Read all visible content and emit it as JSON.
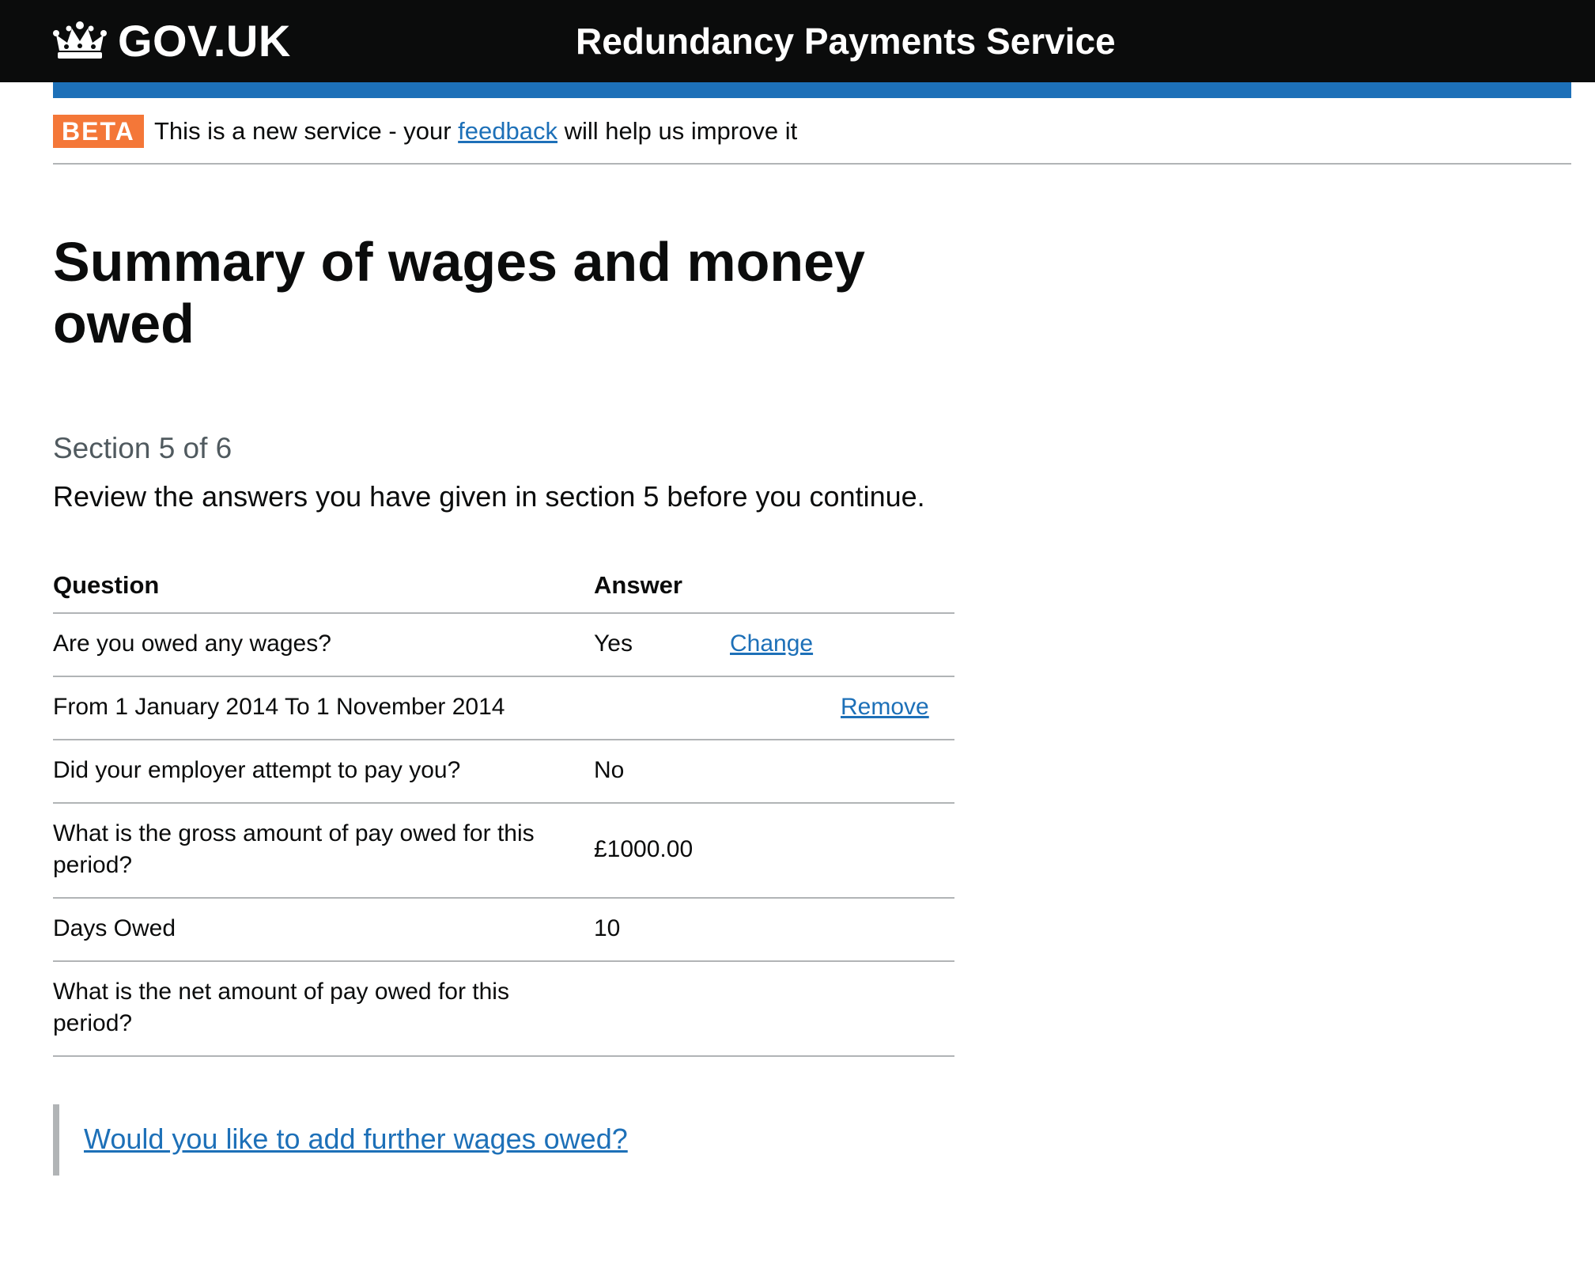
{
  "header": {
    "logo_text": "GOV.UK",
    "service_name": "Redundancy Payments Service",
    "logo_icon": "crown-icon",
    "background": "#0b0c0c",
    "accent_bar": "#1d70b8"
  },
  "phase_banner": {
    "tag": "BETA",
    "tag_color": "#f47738",
    "text_before": "This is a new service - your ",
    "link": "feedback",
    "text_after": " will help us improve it"
  },
  "page": {
    "title": "Summary of wages and money owed",
    "caption": "Section 5 of 6",
    "intro": "Review the answers you have given in section 5 before you continue."
  },
  "summary": {
    "headers": {
      "question": "Question",
      "answer": "Answer"
    },
    "rows": [
      {
        "question": "Are you owed any wages?",
        "answer": "Yes",
        "action": "Change"
      },
      {
        "question": "From 1 January 2014 To 1 November 2014",
        "answer": "",
        "action": "Remove"
      },
      {
        "question": "Did your employer attempt to pay you?",
        "answer": "No",
        "action": ""
      },
      {
        "question": "What is the gross amount of pay owed for this period?",
        "answer": "£1000.00",
        "action": ""
      },
      {
        "question": "Days Owed",
        "answer": "10",
        "action": ""
      },
      {
        "question": "What is the net amount of pay owed for this period?",
        "answer": "",
        "action": ""
      }
    ]
  },
  "add_more": {
    "link": "Would you like to add further wages owed?"
  }
}
